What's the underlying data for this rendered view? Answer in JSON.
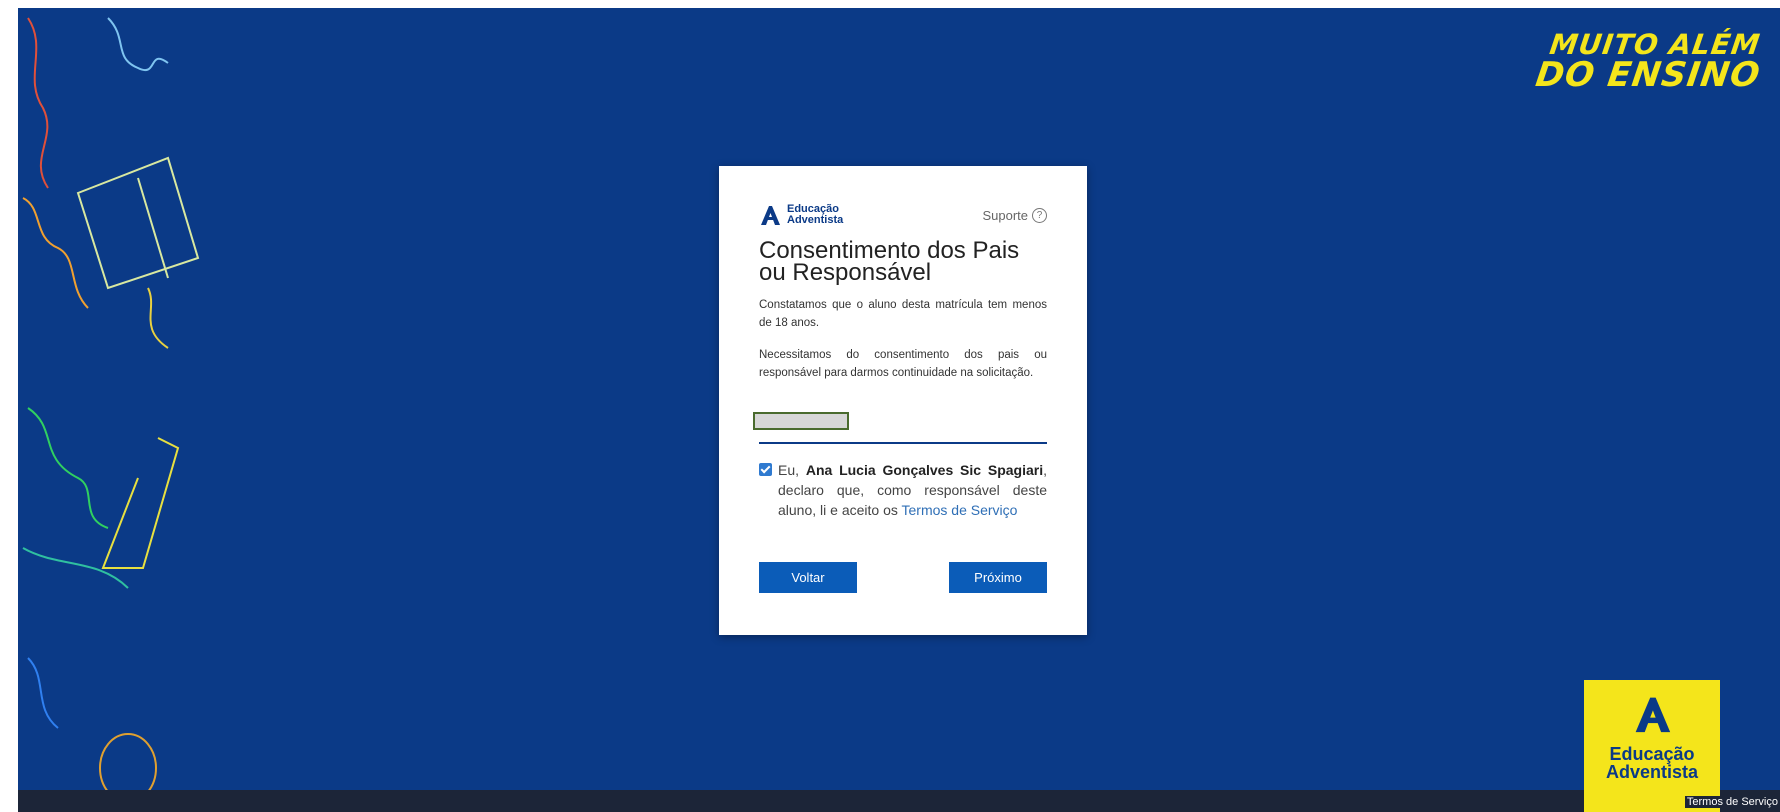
{
  "slogan": {
    "line1": "MUITO ALÉM",
    "line2": "DO ENSINO"
  },
  "card": {
    "brand": {
      "line1": "Educação",
      "line2": "Adventista"
    },
    "support_label": "Suporte",
    "title": "Consentimento dos Pais ou Responsável",
    "paragraph1": "Constatamos que o aluno desta matrícula tem menos de 18 anos.",
    "paragraph2": "Necessitamos do consentimento dos pais ou responsável para darmos continuidade na solicitação.",
    "consent": {
      "prefix": "Eu, ",
      "name": "Ana Lucia Gonçalves Sic Spagiari",
      "middle": ", declaro que, como responsável deste aluno, li e aceito os ",
      "link": "Termos de Serviço",
      "checked": true
    },
    "back_label": "Voltar",
    "next_label": "Próximo"
  },
  "bottom_logo": {
    "line1": "Educação",
    "line2": "Adventista"
  },
  "footer": {
    "terms_link": "Termos de Serviço"
  },
  "colors": {
    "background": "#0b3a87",
    "accent_yellow": "#f4e51b",
    "button": "#0b5cb8"
  }
}
